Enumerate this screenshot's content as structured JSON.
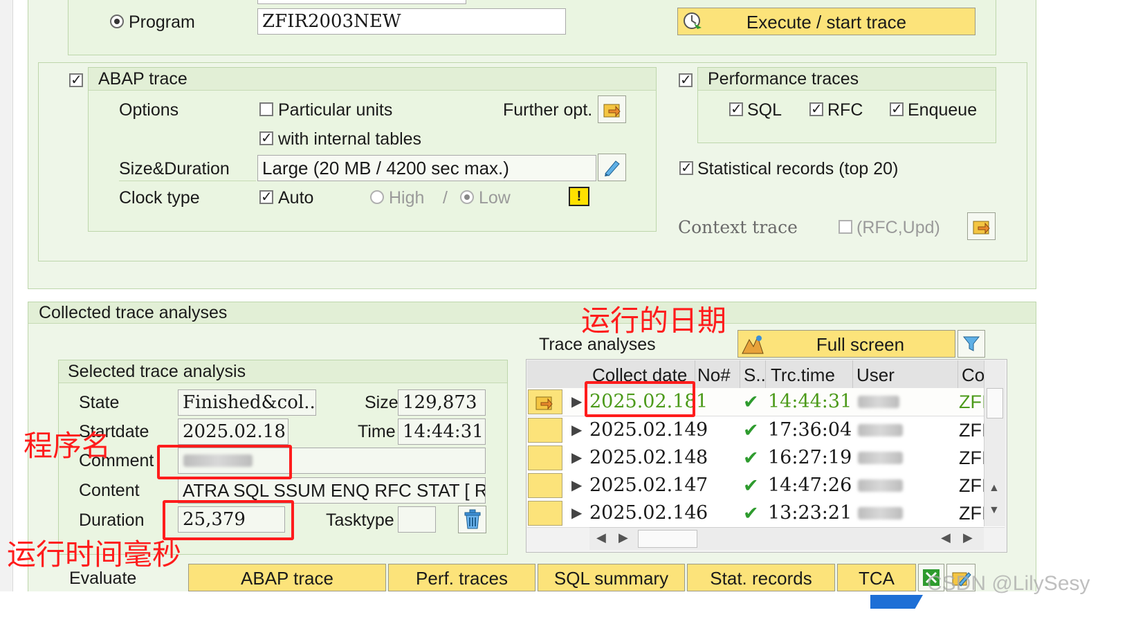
{
  "program": {
    "label": "Program",
    "value": "ZFIR2003NEW",
    "execute_button": "Execute / start trace"
  },
  "abap_trace": {
    "title": "ABAP trace",
    "options_label": "Options",
    "particular_units": "Particular units",
    "further_opt": "Further opt.",
    "with_internal_tables": "with internal tables",
    "size_duration_label": "Size&Duration",
    "size_duration_value": "Large (20 MB / 4200 sec max.)",
    "clock_type_label": "Clock type",
    "auto": "Auto",
    "high": "High",
    "slash": "/",
    "low": "Low",
    "warning": "!"
  },
  "performance_traces": {
    "title": "Performance traces",
    "sql": "SQL",
    "rfc": "RFC",
    "enqueue": "Enqueue",
    "statistical_records": "Statistical records (top 20)",
    "context_trace": "Context trace",
    "rfc_upd": "(RFC,Upd)"
  },
  "collected": {
    "title": "Collected trace analyses",
    "selected": {
      "title": "Selected trace analysis",
      "state_label": "State",
      "state_value": "Finished&col...",
      "size_label": "Size",
      "size_value": "129,873",
      "startdate_label": "Startdate",
      "startdate_value": "2025.02.18",
      "time_label": "Time",
      "time_value": "14:44:31",
      "comment_label": "Comment",
      "content_label": "Content",
      "content_value": "ATRA SQL SSUM ENQ RFC STAT [ Re...",
      "duration_label": "Duration",
      "duration_value": "25,379",
      "tasktype_label": "Tasktype"
    },
    "trace_analyses_label": "Trace analyses",
    "full_screen": "Full screen",
    "table": {
      "headers": [
        "Collect date",
        "No#",
        "S..",
        "Trc.time",
        "User",
        "Co"
      ],
      "rows": [
        {
          "date": "2025.02.18",
          "no": "1",
          "status": "✔",
          "time": "14:44:31",
          "code": "ZFI"
        },
        {
          "date": "2025.02.14",
          "no": "9",
          "status": "✔",
          "time": "17:36:04",
          "code": "ZFI"
        },
        {
          "date": "2025.02.14",
          "no": "8",
          "status": "✔",
          "time": "16:27:19",
          "code": "ZFI"
        },
        {
          "date": "2025.02.14",
          "no": "7",
          "status": "✔",
          "time": "14:47:26",
          "code": "ZFI"
        },
        {
          "date": "2025.02.14",
          "no": "6",
          "status": "✔",
          "time": "13:23:21",
          "code": "ZFI"
        }
      ]
    },
    "evaluate": {
      "label": "Evaluate",
      "buttons": [
        "ABAP trace",
        "Perf. traces",
        "SQL summary",
        "Stat. records",
        "TCA"
      ]
    }
  },
  "annotations": {
    "run_date": "运行的日期",
    "program_name": "程序名",
    "run_time_ms": "运行时间毫秒"
  },
  "watermark": "CSDN @LilySesy",
  "colors": {
    "panel": "#eaf5e1",
    "button": "#fce37a",
    "annotation": "#ff1c1c",
    "check": "#2e9b2e"
  }
}
